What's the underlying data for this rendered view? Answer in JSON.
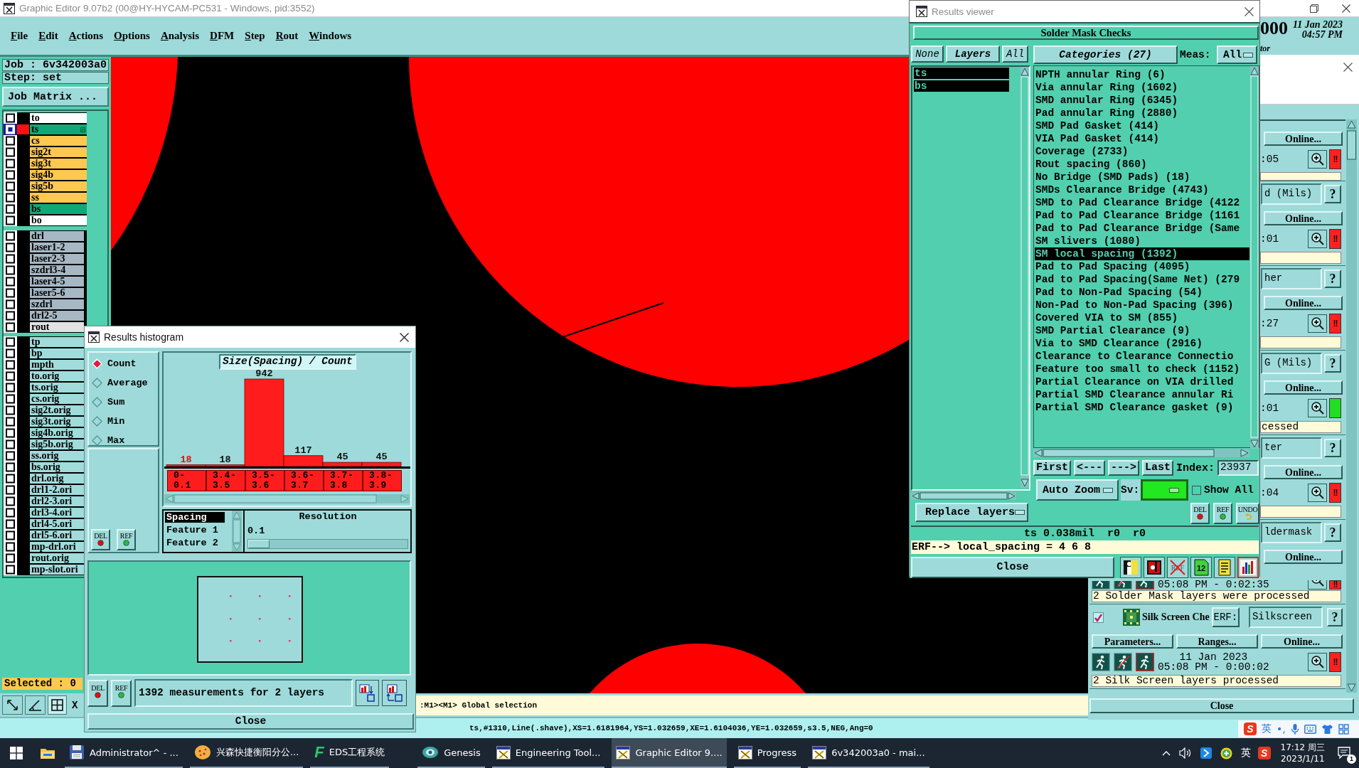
{
  "window": {
    "title": "Graphic Editor 9.07b2 (00@HY-HYCAM-PC531 - Windows, pid:3552)"
  },
  "menu": [
    "File",
    "Edit",
    "Actions",
    "Options",
    "Analysis",
    "DFM",
    "Step",
    "Rout",
    "Windows"
  ],
  "header_info": {
    "version": "000",
    "date": "11 Jan 2023",
    "time": "04:57 PM",
    "user": "tor"
  },
  "job": {
    "job": "Job : 6v342003a0",
    "step": "Step: set",
    "matrix_button": "Job Matrix ..."
  },
  "layer_groups": [
    [
      {
        "name": "to",
        "color": "#ffffff",
        "shown": false,
        "selected": false,
        "marked": false
      },
      {
        "name": "ts",
        "color": "#10a878",
        "shown": true,
        "selected": true,
        "marked": true
      },
      {
        "name": "cs",
        "color": "#ffc850",
        "shown": false,
        "selected": false,
        "marked": false
      },
      {
        "name": "sig2t",
        "color": "#ffc850",
        "shown": false,
        "selected": false,
        "marked": false
      },
      {
        "name": "sig3t",
        "color": "#ffc850",
        "shown": false,
        "selected": false,
        "marked": false
      },
      {
        "name": "sig4b",
        "color": "#ffc850",
        "shown": false,
        "selected": false,
        "marked": false
      },
      {
        "name": "sig5b",
        "color": "#ffc850",
        "shown": false,
        "selected": false,
        "marked": false
      },
      {
        "name": "ss",
        "color": "#ffc850",
        "shown": false,
        "selected": false,
        "marked": false
      },
      {
        "name": "bs",
        "color": "#10a878",
        "shown": false,
        "selected": false,
        "marked": false
      },
      {
        "name": "bo",
        "color": "#ffffff",
        "shown": false,
        "selected": false,
        "marked": false
      }
    ],
    [
      {
        "name": "drl",
        "color": "#a6b8c4",
        "shown": false,
        "selected": false,
        "marked": false
      },
      {
        "name": "laser1-2",
        "color": "#a6b8c4",
        "shown": false,
        "selected": false,
        "marked": false
      },
      {
        "name": "laser2-3",
        "color": "#a6b8c4",
        "shown": false,
        "selected": false,
        "marked": false
      },
      {
        "name": "szdrl3-4",
        "color": "#a6b8c4",
        "shown": false,
        "selected": false,
        "marked": false
      },
      {
        "name": "laser4-5",
        "color": "#a6b8c4",
        "shown": false,
        "selected": false,
        "marked": false
      },
      {
        "name": "laser5-6",
        "color": "#a6b8c4",
        "shown": false,
        "selected": false,
        "marked": false
      },
      {
        "name": "szdrl",
        "color": "#a6b8c4",
        "shown": false,
        "selected": false,
        "marked": false
      },
      {
        "name": "drl2-5",
        "color": "#a6b8c4",
        "shown": false,
        "selected": false,
        "marked": false
      },
      {
        "name": "rout",
        "color": "#e2e2e2",
        "shown": false,
        "selected": false,
        "marked": false
      }
    ],
    [
      {
        "name": "tp",
        "color": "#a0dcdc",
        "shown": false,
        "selected": false,
        "marked": false
      },
      {
        "name": "bp",
        "color": "#a0dcdc",
        "shown": false,
        "selected": false,
        "marked": false
      },
      {
        "name": "mpth",
        "color": "#a0dcdc",
        "shown": false,
        "selected": false,
        "marked": false
      },
      {
        "name": "to.orig",
        "color": "#a0dcdc",
        "shown": false,
        "selected": false,
        "marked": false
      },
      {
        "name": "ts.orig",
        "color": "#a0dcdc",
        "shown": false,
        "selected": false,
        "marked": false
      },
      {
        "name": "cs.orig",
        "color": "#a0dcdc",
        "shown": false,
        "selected": false,
        "marked": false
      },
      {
        "name": "sig2t.orig",
        "color": "#a0dcdc",
        "shown": false,
        "selected": false,
        "marked": false
      },
      {
        "name": "sig3t.orig",
        "color": "#a0dcdc",
        "shown": false,
        "selected": false,
        "marked": false
      },
      {
        "name": "sig4b.orig",
        "color": "#a0dcdc",
        "shown": false,
        "selected": false,
        "marked": false
      },
      {
        "name": "sig5b.orig",
        "color": "#a0dcdc",
        "shown": false,
        "selected": false,
        "marked": false
      },
      {
        "name": "ss.orig",
        "color": "#a0dcdc",
        "shown": false,
        "selected": false,
        "marked": false
      },
      {
        "name": "bs.orig",
        "color": "#a0dcdc",
        "shown": false,
        "selected": false,
        "marked": false
      },
      {
        "name": "drl.orig",
        "color": "#a0dcdc",
        "shown": false,
        "selected": false,
        "marked": false
      },
      {
        "name": "drl1-2.ori",
        "color": "#a0dcdc",
        "shown": false,
        "selected": false,
        "marked": false
      },
      {
        "name": "drl2-3.ori",
        "color": "#a0dcdc",
        "shown": false,
        "selected": false,
        "marked": false
      },
      {
        "name": "drl3-4.ori",
        "color": "#a0dcdc",
        "shown": false,
        "selected": false,
        "marked": false
      },
      {
        "name": "drl4-5.ori",
        "color": "#a0dcdc",
        "shown": false,
        "selected": false,
        "marked": false
      },
      {
        "name": "drl5-6.ori",
        "color": "#a0dcdc",
        "shown": false,
        "selected": false,
        "marked": false
      },
      {
        "name": "mp-drl.ori",
        "color": "#a0dcdc",
        "shown": false,
        "selected": false,
        "marked": false
      },
      {
        "name": "rout.orig",
        "color": "#a0dcdc",
        "shown": false,
        "selected": false,
        "marked": false
      },
      {
        "name": "mp-slot.ori",
        "color": "#a0dcdc",
        "shown": false,
        "selected": false,
        "marked": false
      }
    ]
  ],
  "selection": "Selected : 0",
  "coordinate_label": "X",
  "command_line": ":M1><M1> Global selection",
  "status_line": "ts,#1310,Line(.shave),XS=1.6181964,YS=1.032659,XE=1.6104036,YE=1.032659,s3.5,NEG,Ang=0",
  "histogram": {
    "title": "Results histogram",
    "modes": [
      {
        "label": "Count",
        "selected": true
      },
      {
        "label": "Average",
        "selected": false
      },
      {
        "label": "Sum",
        "selected": false
      },
      {
        "label": "Min",
        "selected": false
      },
      {
        "label": "Max",
        "selected": false
      }
    ],
    "chart_data": {
      "type": "bar",
      "title": "Size(Spacing) / Count",
      "categories": [
        "0-0.1",
        "3.4-3.5",
        "3.5-3.6",
        "3.6-3.7",
        "3.7-3.8",
        "3.8-3.9"
      ],
      "values": [
        18,
        18,
        942,
        117,
        45,
        45
      ],
      "data_labels": true
    },
    "bins": [
      {
        "selected": true
      },
      {
        "selected": false
      },
      {
        "selected": false
      },
      {
        "selected": false
      },
      {
        "selected": false
      },
      {
        "selected": false
      }
    ],
    "fields": [
      {
        "label": "Spacing",
        "selected": true
      },
      {
        "label": "Feature 1",
        "selected": false
      },
      {
        "label": "Feature 2",
        "selected": false
      }
    ],
    "resolution": {
      "label": "Resolution",
      "value": "0.1",
      "level": 0
    },
    "panel_buttons": [
      {
        "kind": "del",
        "label": "DEL"
      },
      {
        "kind": "ref",
        "label": "REF"
      }
    ],
    "footer_buttons": [
      {
        "kind": "del",
        "label": "DEL"
      },
      {
        "kind": "ref",
        "label": "REF"
      }
    ],
    "summary": "1392 measurements for 2 layers",
    "close": "Close"
  },
  "results_viewer": {
    "title": "Results viewer",
    "heading": "Solder Mask Checks",
    "layer_buttons": [
      "None",
      "Layers",
      "All"
    ],
    "layers": [
      {
        "name": "ts",
        "selected": true
      },
      {
        "name": "bs",
        "selected": true
      }
    ],
    "categories_button": "Categories (27)",
    "meas_label": "Meas:",
    "meas_value": "All",
    "categories": [
      {
        "label": "NPTH annular Ring (6)",
        "selected": false
      },
      {
        "label": "Via annular Ring (1602)",
        "selected": false
      },
      {
        "label": "SMD annular Ring (6345)",
        "selected": false
      },
      {
        "label": "Pad annular Ring (2880)",
        "selected": false
      },
      {
        "label": "SMD Pad Gasket (414)",
        "selected": false
      },
      {
        "label": "VIA Pad Gasket (414)",
        "selected": false
      },
      {
        "label": "Coverage (2733)",
        "selected": false
      },
      {
        "label": "Rout spacing (860)",
        "selected": false
      },
      {
        "label": "No Bridge (SMD Pads) (18)",
        "selected": false
      },
      {
        "label": "SMDs Clearance Bridge (4743)",
        "selected": false
      },
      {
        "label": "SMD to Pad Clearance Bridge (4122",
        "selected": false
      },
      {
        "label": "Pad to Pad Clearance Bridge (1161",
        "selected": false
      },
      {
        "label": "Pad to Pad Clearance Bridge (Same",
        "selected": false
      },
      {
        "label": "SM slivers (1080)",
        "selected": false
      },
      {
        "label": "SM local spacing (1392)",
        "selected": true
      },
      {
        "label": "Pad to Pad Spacing (4095)",
        "selected": false
      },
      {
        "label": "Pad to Pad Spacing(Same Net) (279",
        "selected": false
      },
      {
        "label": "Pad to Non-Pad Spacing (54)",
        "selected": false
      },
      {
        "label": "Non-Pad to Non-Pad Spacing (396)",
        "selected": false
      },
      {
        "label": "Covered VIA to SM (855)",
        "selected": false
      },
      {
        "label": "SMD Partial Clearance (9)",
        "selected": false
      },
      {
        "label": "Via to SMD Clearance (2916)",
        "selected": false
      },
      {
        "label": "Clearance to Clearance Connectio",
        "selected": false
      },
      {
        "label": "Feature too small to check (1152)",
        "selected": false
      },
      {
        "label": "Partial Clearance on VIA drilled",
        "selected": false
      },
      {
        "label": "Partial SMD Clearance annular Ri",
        "selected": false
      },
      {
        "label": "Partial SMD Clearance gasket (9)",
        "selected": false
      }
    ],
    "nav_buttons": [
      "First",
      "<---",
      "--->",
      "Last"
    ],
    "index_label": "Index:",
    "index_value": "23937",
    "zoom_mode": "Auto Zoom",
    "sv_label": "Sv:",
    "show_all": {
      "label": "Show All",
      "checked": false
    },
    "action_buttons": [
      {
        "kind": "del",
        "label": "DEL"
      },
      {
        "kind": "ref",
        "label": "REF"
      },
      {
        "kind": "undo",
        "label": "UNDO"
      }
    ],
    "replace_mode": "Replace layers",
    "measure_line": "ts 0.038mil  r0  r0",
    "erf_line": "ERF--> local_spacing = 4 6 8",
    "close": "Close",
    "tools": [
      {
        "kind": "person",
        "selected": false
      },
      {
        "kind": "record",
        "selected": false
      },
      {
        "kind": "ref-cross",
        "label": "REF",
        "selected": false
      },
      {
        "kind": "numbered",
        "label": "12",
        "selected": false
      },
      {
        "kind": "notes",
        "selected": false
      },
      {
        "kind": "histogram",
        "selected": true
      }
    ]
  },
  "checks_panel": {
    "items": [
      {
        "kind": "covered",
        "buttons": [
          "Online..."
        ],
        "time": ":05",
        "color": "#ff2020",
        "mark": "!!"
      },
      {
        "kind": "covered",
        "field": "d (Mils)",
        "help": "?",
        "buttons": [
          "Online..."
        ],
        "time": ":01",
        "color": "#ff2020",
        "mark": "!!"
      },
      {
        "kind": "covered",
        "field": "her",
        "help": "?",
        "buttons": [
          "Online..."
        ],
        "time": ":27",
        "color": "#ff2020",
        "mark": "!!"
      },
      {
        "kind": "covered",
        "field": "G (Mils)",
        "help": "?",
        "buttons": [
          "Online..."
        ],
        "time": ":01",
        "color": "#22dd22",
        "message": "cessed"
      },
      {
        "kind": "covered",
        "field": "ter",
        "help": "?",
        "buttons": [
          "Online..."
        ],
        "time": ":04",
        "color": "#ff2020",
        "mark": "!!"
      },
      {
        "kind": "half",
        "field": "ldermask",
        "help": "?",
        "buttons": [
          "Online..."
        ],
        "time": "05:08 PM - 0:02:35",
        "color": "#ff2020",
        "mark": "!!",
        "message": "2 Solder Mask layers were processed"
      },
      {
        "kind": "open",
        "checked": true,
        "name": "Silk Screen Che",
        "erf": "ERF:",
        "field": "Silkscreen",
        "help": "?",
        "buttons": [
          "Parameters...",
          "Ranges...",
          "Online..."
        ],
        "date": "11 Jan 2023",
        "time": "05:08 PM - 0:00:02",
        "color": "#ff2020",
        "mark": "!!",
        "message": "2 Silk Screen layers processed"
      }
    ],
    "close": "Close"
  },
  "ime_bar": [
    {
      "kind": "logo",
      "text": "S"
    },
    {
      "kind": "text",
      "text": "英"
    },
    {
      "kind": "text",
      "text": "•,"
    },
    {
      "kind": "mic"
    },
    {
      "kind": "keyboard"
    },
    {
      "kind": "shirt"
    },
    {
      "kind": "grid"
    }
  ],
  "taskbar": {
    "items": [
      {
        "kind": "disk",
        "label": "Administrator^ - ...",
        "selected": false
      },
      {
        "kind": "ball",
        "label": "兴森快捷衡阳分公...",
        "selected": false
      },
      {
        "kind": "logo",
        "logo": "F",
        "label": "EDS工程系统",
        "selected": false
      },
      {
        "kind": "swirl",
        "label": "Genesis",
        "selected": false
      },
      {
        "kind": "xwin",
        "label": "Engineering Tool...",
        "selected": false
      },
      {
        "kind": "xwin",
        "label": "Graphic Editor 9....",
        "selected": true
      },
      {
        "kind": "xwin",
        "label": "Progress",
        "selected": false
      },
      {
        "kind": "xwin",
        "label": "6v342003a0 - mai...",
        "selected": false
      }
    ],
    "tray": [
      {
        "kind": "chevron"
      },
      {
        "kind": "speaker"
      },
      {
        "kind": "arrow"
      },
      {
        "kind": "plus"
      },
      {
        "kind": "text",
        "text": "英"
      },
      {
        "kind": "logo",
        "text": "S"
      }
    ],
    "time": "17:12 周三",
    "date": "2023/1/11",
    "notifications": "1"
  }
}
